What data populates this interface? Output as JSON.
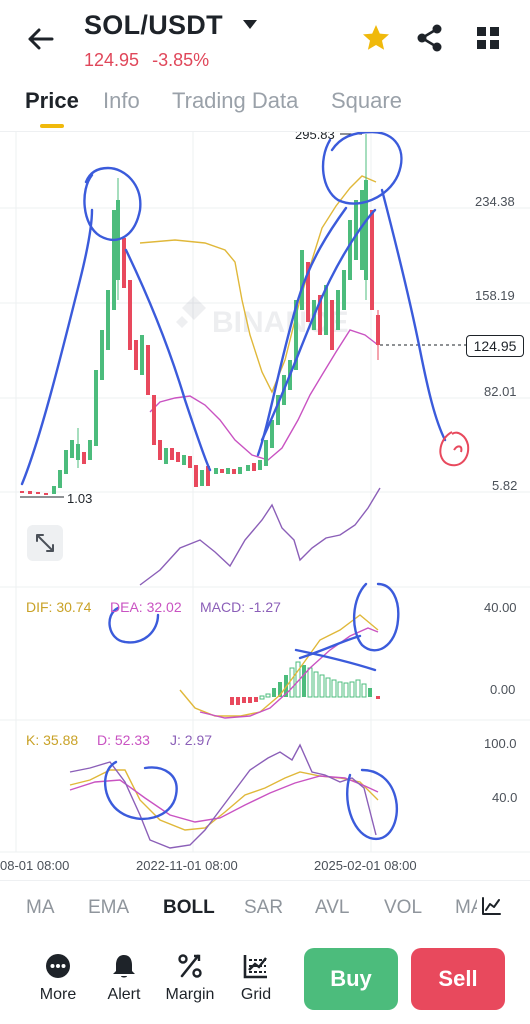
{
  "header": {
    "pair": "SOL/USDT",
    "price": "124.95",
    "change": "-3.85%"
  },
  "tabs": [
    {
      "label": "Price",
      "active": true
    },
    {
      "label": "Info",
      "active": false
    },
    {
      "label": "Trading Data",
      "active": false
    },
    {
      "label": "Square",
      "active": false
    }
  ],
  "chart": {
    "high_label": "295.83",
    "low_label": "1.03",
    "current_price": "124.95",
    "price_axis": [
      "234.38",
      "158.19",
      "82.01",
      "5.82"
    ],
    "watermark": "BINANCE",
    "x_labels": [
      "08-01 08:00",
      "2022-11-01 08:00",
      "2025-02-01 08:00"
    ]
  },
  "macd": {
    "dif": "DIF: 30.74",
    "dea": "DEA: 32.02",
    "macd": "MACD: -1.27",
    "axis": [
      "40.00",
      "0.00"
    ]
  },
  "kdj": {
    "k": "K: 35.88",
    "d": "D: 52.33",
    "j": "J: 2.97",
    "axis": [
      "100.0",
      "40.0"
    ]
  },
  "indicators": [
    "MA",
    "EMA",
    "BOLL",
    "SAR",
    "AVL",
    "VOL",
    "MA"
  ],
  "indicator_active": "BOLL",
  "bottom_nav": [
    {
      "label": "More",
      "icon": "more-icon"
    },
    {
      "label": "Alert",
      "icon": "bell-icon"
    },
    {
      "label": "Margin",
      "icon": "percent-icon"
    },
    {
      "label": "Grid",
      "icon": "grid-chart-icon"
    }
  ],
  "actions": {
    "buy": "Buy",
    "sell": "Sell"
  },
  "colors": {
    "up": "#4cbc7c",
    "down": "#e8495d",
    "accent": "#f0b90b",
    "annotation": "#3b5bdb"
  }
}
